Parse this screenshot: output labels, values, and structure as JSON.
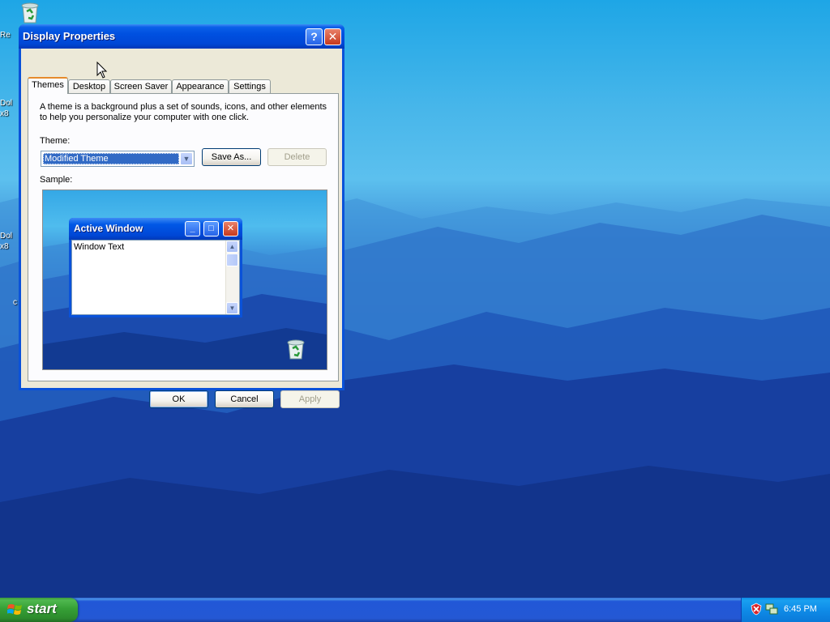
{
  "window": {
    "title": "Display Properties",
    "help_glyph": "?",
    "close_glyph": "✕"
  },
  "tabs": [
    {
      "label": "Themes",
      "active": true
    },
    {
      "label": "Desktop",
      "active": false
    },
    {
      "label": "Screen Saver",
      "active": false
    },
    {
      "label": "Appearance",
      "active": false
    },
    {
      "label": "Settings",
      "active": false
    }
  ],
  "themes_tab": {
    "description_line1": "A theme is a background plus a set of sounds, icons, and other elements",
    "description_line2": "to help you personalize your computer with one click.",
    "theme_label": "Theme:",
    "theme_selected": "Modified Theme",
    "save_as_label": "Save As...",
    "delete_label": "Delete",
    "sample_label": "Sample:"
  },
  "sample_window": {
    "title": "Active Window",
    "body_text": "Window Text"
  },
  "buttons": {
    "ok": "OK",
    "cancel": "Cancel",
    "apply": "Apply"
  },
  "desktop_icons": [
    {
      "label": "Re"
    },
    {
      "label": "Dol"
    },
    {
      "label": "x8"
    },
    {
      "label": "Dol"
    },
    {
      "label": "x8"
    },
    {
      "label": "c"
    }
  ],
  "taskbar": {
    "start_label": "start",
    "clock": "6:45 PM"
  },
  "icons": {
    "recycle_bin": "recycle-bin-icon",
    "windows_logo": "windows-logo-icon",
    "tray_security": "security-alert-icon",
    "tray_network": "network-icon"
  },
  "colors": {
    "xp_blue_title": "#0050e0",
    "selection": "#316ac5",
    "close_red": "#c7391d",
    "start_green": "#36a036",
    "tab_active_accent": "#e68b2c"
  }
}
